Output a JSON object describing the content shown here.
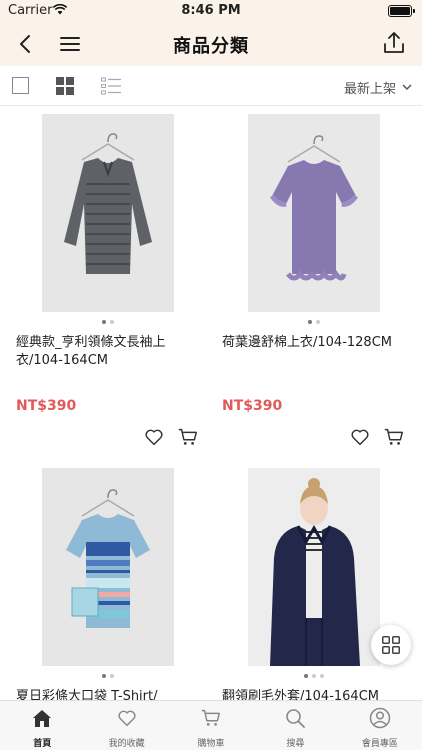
{
  "status": {
    "carrier": "Carrier",
    "time": "8:46 PM"
  },
  "nav": {
    "title": "商品分類"
  },
  "toolbar": {
    "sort_label": "最新上架"
  },
  "products": [
    {
      "name": "經典款_亨利領條文長袖上衣/104-164CM",
      "price": "NT$390"
    },
    {
      "name": "荷葉邊舒棉上衣/104-128CM",
      "price": "NT$390"
    },
    {
      "name": "夏日彩條大口袋 T-Shirt/"
    },
    {
      "name": "翻領刷毛外套/104-164CM"
    }
  ],
  "tabs": [
    {
      "label": "首頁",
      "icon": "home-icon"
    },
    {
      "label": "我的收藏",
      "icon": "heart-icon"
    },
    {
      "label": "購物車",
      "icon": "cart-icon"
    },
    {
      "label": "搜尋",
      "icon": "search-icon"
    },
    {
      "label": "會員專區",
      "icon": "user-icon"
    }
  ],
  "colors": {
    "header_bg": "#fbf3e9",
    "price": "#e05a5a",
    "text": "#222222"
  }
}
